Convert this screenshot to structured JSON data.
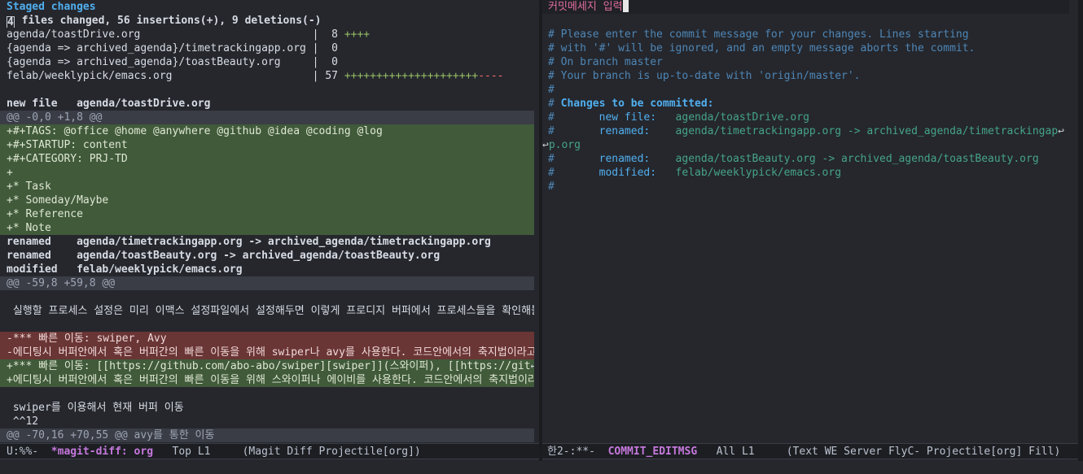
{
  "left": {
    "section_title": "Staged changes",
    "summary": " files changed, 56 insertions(+), 9 deletions(-)",
    "summary_lead": "4",
    "stats": [
      {
        "file": "agenda/toastDrive.org                          ",
        "sep": " |  8 ",
        "plus": "++++",
        "minus": ""
      },
      {
        "file": "{agenda => archived_agenda}/timetrackingapp.org",
        "sep": " |  0",
        "plus": "",
        "minus": ""
      },
      {
        "file": "{agenda => archived_agenda}/toastBeauty.org    ",
        "sep": " |  0",
        "plus": "",
        "minus": ""
      },
      {
        "file": "felab/weeklypick/emacs.org                     ",
        "sep": " | 57 ",
        "plus": "+++++++++++++++++++++",
        "minus": "----"
      }
    ],
    "newfile_label": "new file   agenda/toastDrive.org",
    "hunk1": "@@ -0,0 +1,8 @@",
    "added_lines": [
      "+#+TAGS: @office @home @anywhere @github @idea @coding @log",
      "+#+STARTUP: content",
      "+#+CATEGORY: PRJ-TD",
      "+",
      "+* Task",
      "+* Someday/Maybe",
      "+* Reference",
      "+* Note"
    ],
    "renamed1": "renamed    agenda/timetrackingapp.org -> archived_agenda/timetrackingapp.org",
    "renamed2": "renamed    agenda/toastBeauty.org -> archived_agenda/toastBeauty.org",
    "modified1": "modified   felab/weeklypick/emacs.org",
    "hunk2": "@@ -59,8 +59,8 @@",
    "ctx1": " 실행할 프로세스 설정은 미리 이맥스 설정파일에서 설정해두면 이렇게 프로디지 버퍼에서 프로세스들을 확인해볼 수 있",
    "del1": "-*** 빠른 이동: swiper, Avy",
    "del2": "-에디팅시 버퍼안에서 혹은 버퍼간의 빠른 이동을 위해 swiper나 avy를 사용한다. 코드안에서의 축지법이라고나 할",
    "add1": "+*** 빠른 이동: [[https://github.com/abo-abo/swiper][swiper]](스와이퍼), [[https://git",
    "add2": "+에디팅시 버퍼안에서 혹은 버퍼간의 빠른 이동을 위해 스와이퍼나 에이비를 사용한다. 코드안에서의 축지법이라고나 할",
    "ctx2": " swiper를 이용해서 현재 버퍼 이동",
    "ctx3": " ^^12",
    "hunk3": "@@ -70,16 +70,55 @@ avy를 통한 이동",
    "cont_mark": "↩"
  },
  "right": {
    "title": "커밋메세지 입력",
    "comments": [
      "# Please enter the commit message for your changes. Lines starting",
      "# with '#' will be ignored, and an empty message aborts the commit.",
      "# On branch master",
      "# Your branch is up-to-date with 'origin/master'.",
      "#"
    ],
    "changes_prefix": "# ",
    "changes_heading": "Changes to be committed:",
    "entries": [
      {
        "prefix": "#       ",
        "label": "new file:   ",
        "value": "agenda/toastDrive.org"
      },
      {
        "prefix": "#       ",
        "label": "renamed:    ",
        "value": "agenda/timetrackingapp.org -> archived_agenda/timetrackingap"
      },
      {
        "prefix": "#       ",
        "label": "renamed:    ",
        "value": "agenda/toastBeauty.org -> archived_agenda/toastBeauty.org"
      },
      {
        "prefix": "#       ",
        "label": "modified:   ",
        "value": "felab/weeklypick/emacs.org"
      }
    ],
    "wrap_tail": "p.org",
    "trailing_hash": "#",
    "wrap_mark": "↩"
  },
  "modeline_left": {
    "state": "U:%%-  ",
    "buffer": "*magit-diff: org",
    "position": "   Top L1     ",
    "modes": "(Magit Diff Projectile[org])"
  },
  "modeline_right": {
    "state": "한2-:**-  ",
    "buffer": "COMMIT_EDITMSG",
    "position": "   All L1     ",
    "modes": "(Text WE Server FlyC- Projectile[org] Fill)"
  }
}
